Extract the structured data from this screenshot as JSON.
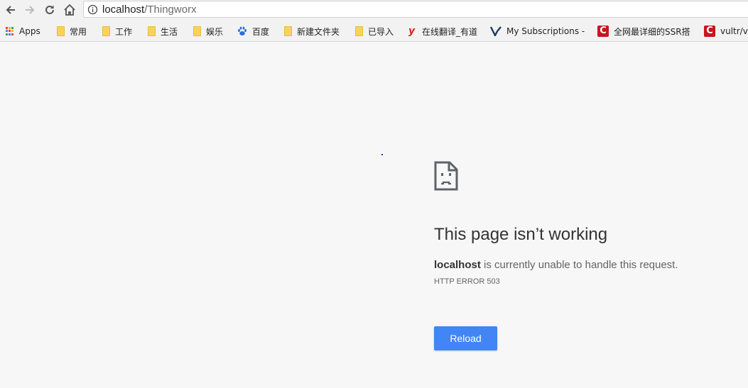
{
  "toolbar": {
    "url_host": "localhost",
    "url_path": "/Thingworx",
    "icons": [
      "back-arrow-icon",
      "forward-arrow-icon",
      "reload-icon",
      "home-icon",
      "info-icon"
    ]
  },
  "bookmarks": [
    {
      "label": "Apps",
      "icon": "apps-grid-icon"
    },
    {
      "label": "常用",
      "icon": "folder-icon"
    },
    {
      "label": "工作",
      "icon": "folder-icon"
    },
    {
      "label": "生活",
      "icon": "folder-icon"
    },
    {
      "label": "娱乐",
      "icon": "folder-icon"
    },
    {
      "label": "百度",
      "icon": "baidu-paw-icon"
    },
    {
      "label": "新建文件夹",
      "icon": "folder-icon"
    },
    {
      "label": "已导入",
      "icon": "folder-icon"
    },
    {
      "label": "在线翻译_有道",
      "icon": "youdao-icon"
    },
    {
      "label": "My Subscriptions -",
      "icon": "v-logo-icon"
    },
    {
      "label": "全网最详细的SSR搭",
      "icon": "csdn-icon"
    },
    {
      "label": "vultr/v",
      "icon": "csdn-icon"
    }
  ],
  "error": {
    "title": "This page isn’t working",
    "host": "localhost",
    "message": " is currently unable to handle this request.",
    "code": "HTTP ERROR 503",
    "reload_label": "Reload",
    "icon": "sad-document-icon"
  },
  "colors": {
    "accent": "#4285f4",
    "background": "#f7f7f7",
    "folder": "#f7d35b",
    "csdn": "#c8161d"
  }
}
